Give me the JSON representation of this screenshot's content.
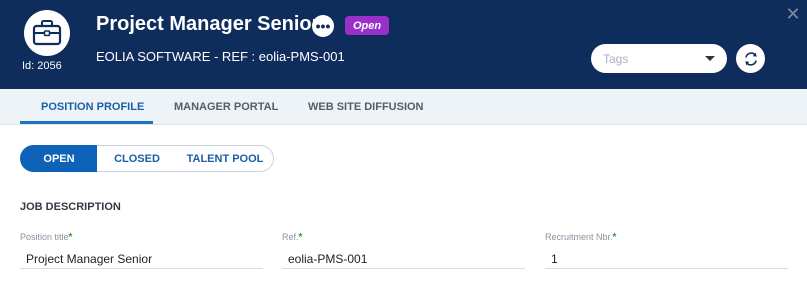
{
  "header": {
    "id_label": "Id: 2056",
    "title": "Project Manager Senior",
    "more_icon": "more-dots-icon",
    "status": "Open",
    "subtitle": "EOLIA SOFTWARE - REF : eolia-PMS-001",
    "tags_placeholder": "Tags",
    "refresh_icon": "refresh-icon",
    "close_icon": "close-icon",
    "colors": {
      "header_bg": "#0f2d5c",
      "status_badge": "#9b2fc9"
    }
  },
  "tabs": [
    {
      "label": "POSITION PROFILE",
      "active": true
    },
    {
      "label": "MANAGER PORTAL",
      "active": false
    },
    {
      "label": "WEB SITE DIFFUSION",
      "active": false
    }
  ],
  "status_options": [
    {
      "label": "OPEN",
      "active": true
    },
    {
      "label": "CLOSED",
      "active": false
    },
    {
      "label": "TALENT POOL",
      "active": false
    }
  ],
  "job_description": {
    "section_title": "JOB DESCRIPTION",
    "fields": [
      {
        "label": "Position title",
        "required": "*",
        "value": "Project Manager Senior"
      },
      {
        "label": "Ref.",
        "required": "*",
        "value": "eolia-PMS-001"
      },
      {
        "label": "Recruitment Nbr.",
        "required": "*",
        "value": "1"
      }
    ]
  }
}
